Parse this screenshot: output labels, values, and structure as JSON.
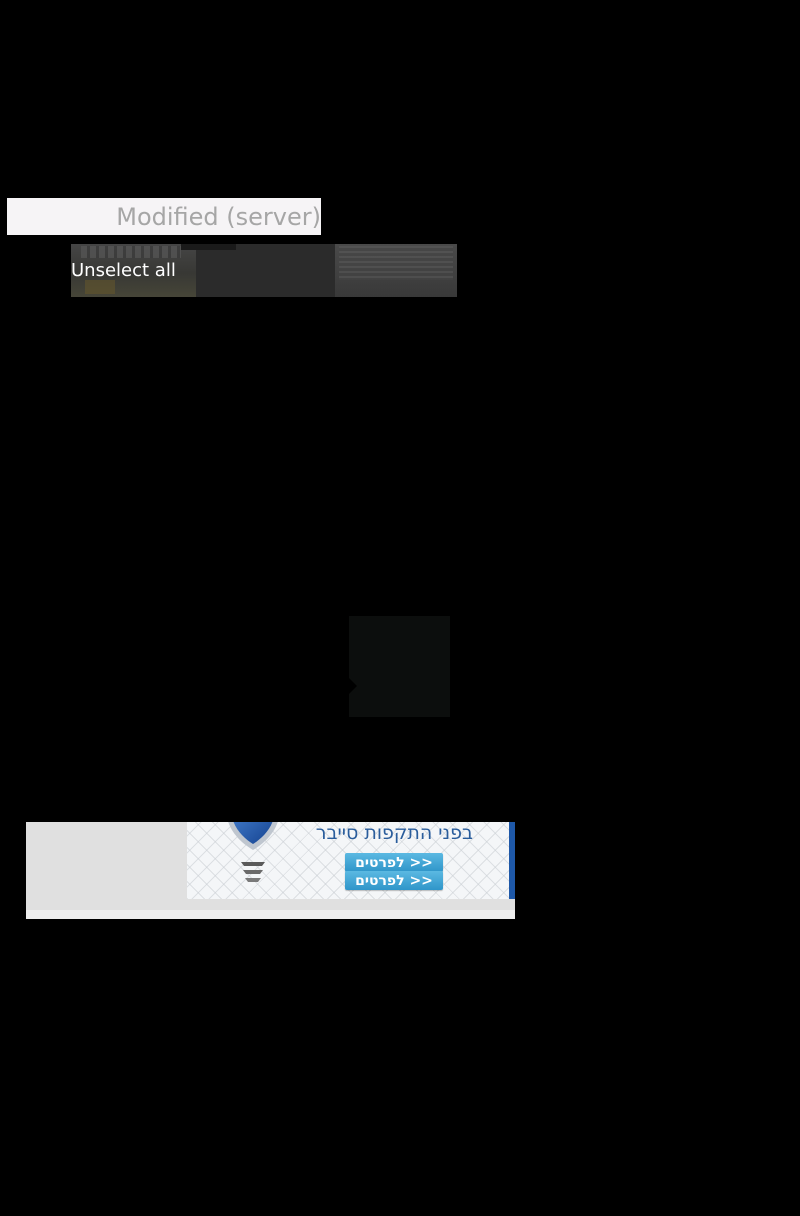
{
  "sort_option": {
    "label": "Modified (server)"
  },
  "selection_bar": {
    "unselect_label": "Unselect all"
  },
  "ad": {
    "headline": "בפני התקפות סייבר",
    "cta_buttons": [
      "לפרטים >>",
      "לפרטים >>"
    ],
    "icons": [
      "shield-icon"
    ]
  },
  "colors": {
    "background": "#000000",
    "sort_label_bg": "#f6f4f6",
    "sort_label_text": "#a6a6a6",
    "ad_accent": "#1e58a8",
    "ad_button": "#2f95c9"
  }
}
